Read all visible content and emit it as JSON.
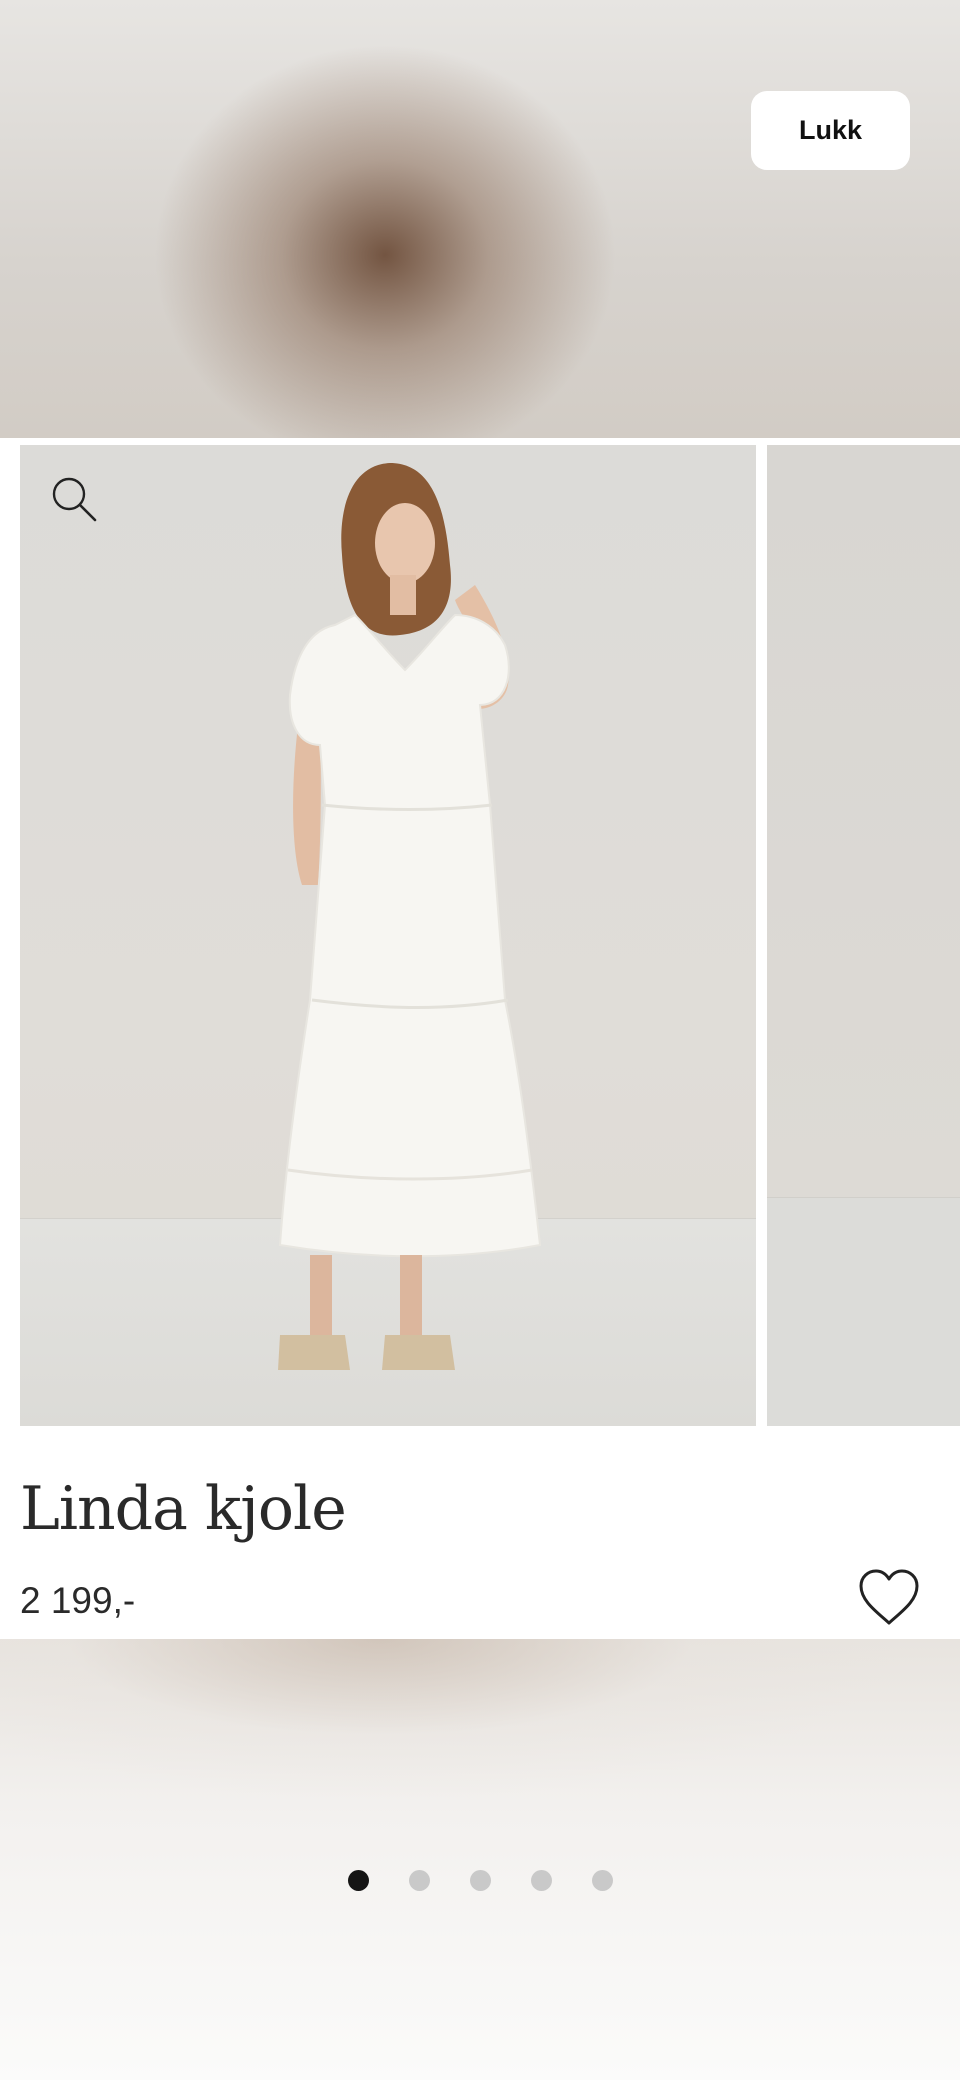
{
  "header": {
    "close_label": "Lukk"
  },
  "product": {
    "name": "Linda kjole",
    "price": "2 199,-",
    "image_count": 5,
    "active_image": 1
  },
  "icons": {
    "zoom": "search-icon",
    "favorite": "heart-icon"
  },
  "colors": {
    "text": "#2a2a2a",
    "dot_active": "#151515",
    "dot_inactive": "#c9c9c9"
  }
}
